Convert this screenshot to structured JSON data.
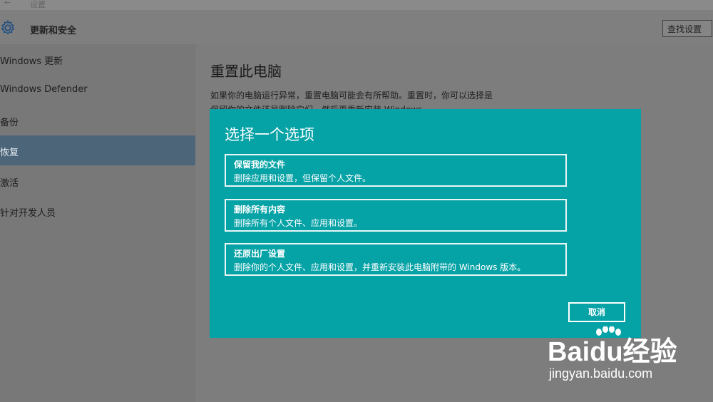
{
  "window": {
    "back_glyph": "←",
    "app_title": "设置"
  },
  "header": {
    "title": "更新和安全",
    "search_label": "查找设置",
    "icon": "gear-icon"
  },
  "sidebar": {
    "items": [
      {
        "label": "Windows 更新",
        "active": false
      },
      {
        "label": "Windows Defender",
        "active": false
      },
      {
        "label": "备份",
        "active": false
      },
      {
        "label": "恢复",
        "active": true
      },
      {
        "label": "激活",
        "active": false
      },
      {
        "label": "针对开发人员",
        "active": false
      }
    ]
  },
  "content": {
    "title": "重置此电脑",
    "description": "如果你的电脑运行异常，重置电脑可能会有所帮助。重置时，你可以选择是保留你的文件还是删除它们，然后再重新安装 Windows。"
  },
  "dialog": {
    "title": "选择一个选项",
    "options": [
      {
        "title": "保留我的文件",
        "desc": "删除应用和设置，但保留个人文件。"
      },
      {
        "title": "删除所有内容",
        "desc": "删除所有个人文件、应用和设置。"
      },
      {
        "title": "还原出厂设置",
        "desc": "删除你的个人文件、应用和设置，并重新安装此电脑附带的 Windows 版本。"
      }
    ],
    "cancel_label": "取消"
  },
  "watermark": {
    "logo_text": "Baidu经验",
    "url": "jingyan.baidu.com"
  },
  "colors": {
    "dialog_bg": "#05a2a6",
    "sidebar_active": "#4d6579"
  }
}
